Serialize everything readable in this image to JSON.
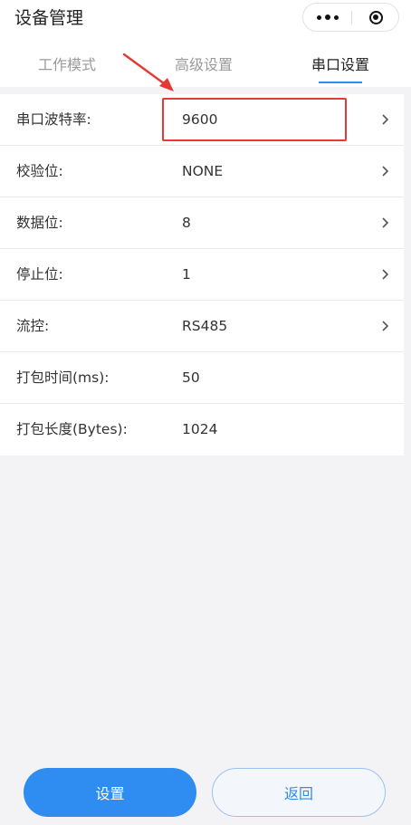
{
  "header": {
    "title": "设备管理"
  },
  "capsule": {
    "more_icon": "more-dots-icon",
    "close_icon": "target-icon"
  },
  "tabs": [
    {
      "label": "工作模式",
      "active": false
    },
    {
      "label": "高级设置",
      "active": false
    },
    {
      "label": "串口设置",
      "active": true
    }
  ],
  "settings": [
    {
      "label": "串口波特率:",
      "value": "9600",
      "chevron": true
    },
    {
      "label": "校验位:",
      "value": "NONE",
      "chevron": true
    },
    {
      "label": "数据位:",
      "value": "8",
      "chevron": true
    },
    {
      "label": "停止位:",
      "value": "1",
      "chevron": true
    },
    {
      "label": "流控:",
      "value": "RS485",
      "chevron": true
    },
    {
      "label": "打包时间(ms):",
      "value": "50",
      "chevron": false
    },
    {
      "label": "打包长度(Bytes):",
      "value": "1024",
      "chevron": false
    }
  ],
  "buttons": {
    "set": "设置",
    "back": "返回"
  },
  "colors": {
    "accent": "#2f8cf0",
    "annotation": "#e53935"
  }
}
